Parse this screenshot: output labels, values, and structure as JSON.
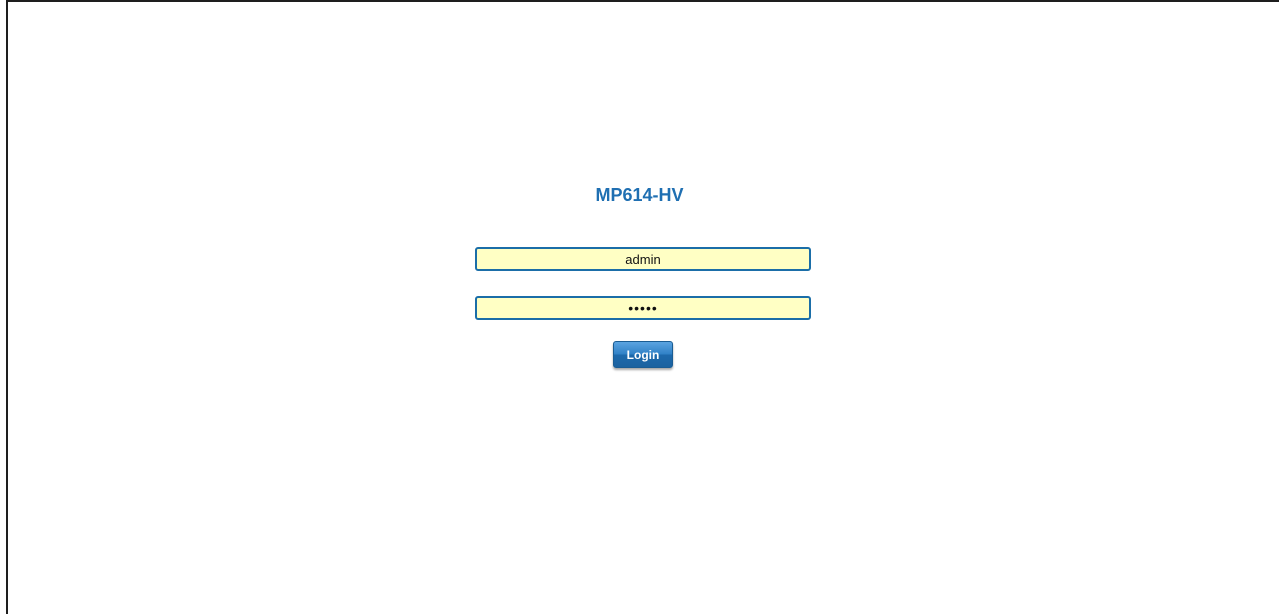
{
  "login": {
    "title": "MP614-HV",
    "username_value": "admin",
    "password_value": "•••••",
    "button_label": "Login"
  },
  "colors": {
    "title": "#1f6fb2",
    "field_background": "#ffffc4",
    "field_border": "#1b6ea8",
    "button": "#2f80c6"
  }
}
